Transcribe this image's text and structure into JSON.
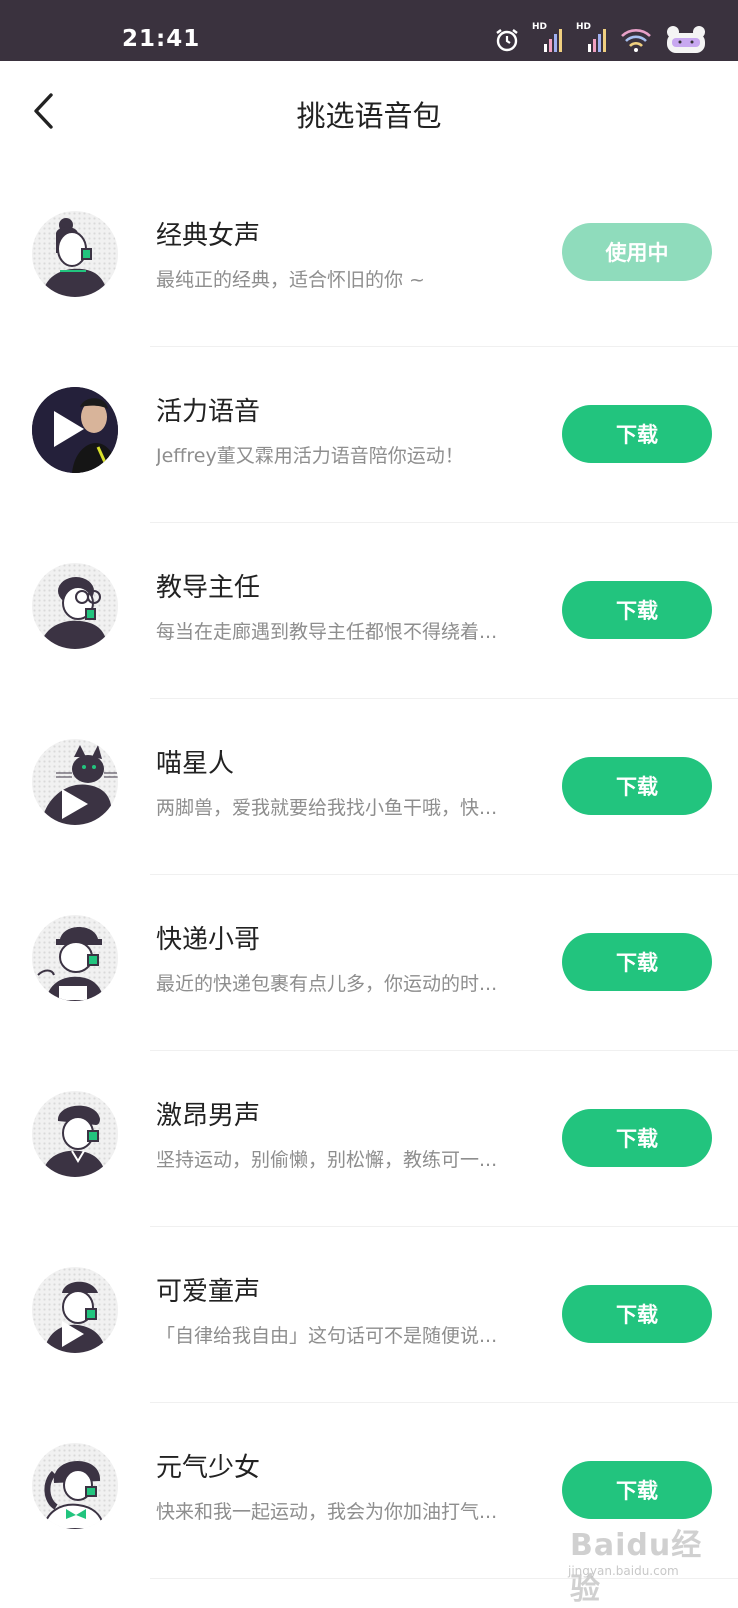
{
  "status_bar": {
    "time": "21:41",
    "icons": [
      "alarm-icon",
      "hd-signal-icon",
      "hd-signal-icon",
      "wifi-icon",
      "battery-icon"
    ],
    "hd_label": "HD"
  },
  "header": {
    "title": "挑选语音包",
    "back_icon": "chevron-left-icon"
  },
  "voice_packs": [
    {
      "title": "经典女声",
      "desc": "最纯正的经典，适合怀旧的你 ~",
      "action": "使用中",
      "state": "in-use"
    },
    {
      "title": "活力语音",
      "desc": "Jeffrey董又霖用活力语音陪你运动！",
      "action": "下载",
      "state": "download"
    },
    {
      "title": "教导主任",
      "desc": "每当在走廊遇到教导主任都恨不得绕着...",
      "action": "下载",
      "state": "download"
    },
    {
      "title": "喵星人",
      "desc": "两脚兽，爱我就要给我找小鱼干哦，快...",
      "action": "下载",
      "state": "download"
    },
    {
      "title": "快递小哥",
      "desc": "最近的快递包裹有点儿多，你运动的时...",
      "action": "下载",
      "state": "download"
    },
    {
      "title": "激昂男声",
      "desc": "坚持运动，别偷懒，别松懈，教练可一...",
      "action": "下载",
      "state": "download"
    },
    {
      "title": "可爱童声",
      "desc": "「自律给我自由」这句话可不是随便说...",
      "action": "下载",
      "state": "download"
    },
    {
      "title": "元气少女",
      "desc": "快来和我一起运动，我会为你加油打气...",
      "action": "下载",
      "state": "download"
    }
  ],
  "watermark": {
    "text": "Baidu经验",
    "sub": "jingyan.baidu.com"
  },
  "colors": {
    "status_bar_bg": "#3a323e",
    "accent_green": "#22c47e",
    "in_use_green": "#8fdcbc",
    "title_text": "#222222",
    "desc_text": "#8e8e8e"
  }
}
